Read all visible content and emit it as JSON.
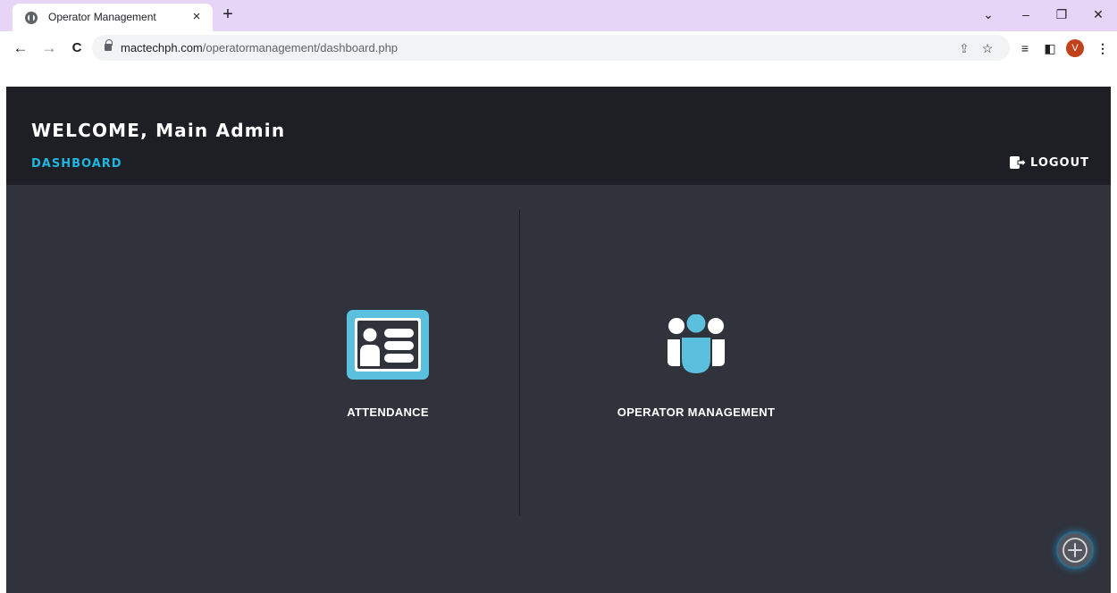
{
  "browser": {
    "tab_title": "Operator Management",
    "tab_close": "×",
    "new_tab": "+",
    "url_host": "mactechph.com",
    "url_path": "/operatormanagement/dashboard.php",
    "profile_initial": "V"
  },
  "header": {
    "welcome": "WELCOME, Main Admin",
    "nav_link": "DASHBOARD",
    "logout_label": "LOGOUT"
  },
  "modules": [
    {
      "label": "ATTENDANCE",
      "icon": "id-card-icon"
    },
    {
      "label": "OPERATOR MANAGEMENT",
      "icon": "users-group-icon"
    }
  ],
  "colors": {
    "header_bg": "#1e1f24",
    "page_bg": "#30323c",
    "accent": "#1fb6e0",
    "icon_accent": "#5bc0de",
    "tabstrip": "#e6d5f7",
    "avatar": "#c1411a"
  }
}
